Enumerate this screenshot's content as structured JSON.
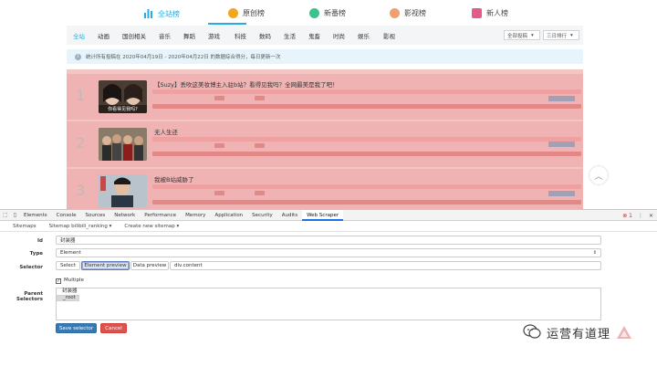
{
  "site": {
    "category_tabs": [
      {
        "label": "全站榜",
        "active": true,
        "icon": "bar-chart-icon",
        "color": "#23ade5"
      },
      {
        "label": "原创榜",
        "active": false,
        "icon": "star-icon",
        "color": "#f3a421"
      },
      {
        "label": "新番榜",
        "active": false,
        "icon": "anime-icon",
        "color": "#3ac48c"
      },
      {
        "label": "影视榜",
        "active": false,
        "icon": "film-reel-icon",
        "color": "#f2a06b"
      },
      {
        "label": "新人榜",
        "active": false,
        "icon": "gift-icon",
        "color": "#e65a8a"
      }
    ],
    "sub_nav": [
      "全站",
      "动画",
      "国创相关",
      "音乐",
      "舞蹈",
      "游戏",
      "科技",
      "数码",
      "生活",
      "鬼畜",
      "时尚",
      "娱乐",
      "影视"
    ],
    "filter_select": "全部投稿",
    "range_select": "三日排行",
    "notice": "统计所有投稿在 2020年04月19日 - 2020年04月22日 的数据综合得分，每日更新一次",
    "rank_items": [
      {
        "rank": "1",
        "title": "【Suzy】丢吹这美妆博主入驻b站？看得见我吗？全网最美是我了吧！",
        "thumb_caption": "你看得见我吗?"
      },
      {
        "rank": "2",
        "title": "无人生还",
        "thumb_caption": ""
      },
      {
        "rank": "3",
        "title": "我被B站威胁了",
        "thumb_caption": ""
      }
    ]
  },
  "devtools": {
    "tabs": [
      "Elements",
      "Console",
      "Sources",
      "Network",
      "Performance",
      "Memory",
      "Application",
      "Security",
      "Audits",
      "Web Scraper"
    ],
    "active_tab": "Web Scraper",
    "error_count": "1",
    "scraper_nav": [
      "Sitemaps",
      "Sitemap bilibili_ranking ▾",
      "Create new sitemap ▾"
    ],
    "form": {
      "id_label": "Id",
      "id_value": "封装器",
      "type_label": "Type",
      "type_value": "Element",
      "selector_label": "Selector",
      "select_btn": "Select",
      "element_preview_btn": "Element preview",
      "data_preview_btn": "Data preview",
      "selector_value": "div.content",
      "multiple_label": "Multiple",
      "multiple_checked": true,
      "parent_label": "Parent Selectors",
      "parent_options": [
        "_root",
        "封装器"
      ],
      "save_btn": "Save selector",
      "cancel_btn": "Cancel"
    }
  },
  "watermark": {
    "text": "运营有道理"
  }
}
